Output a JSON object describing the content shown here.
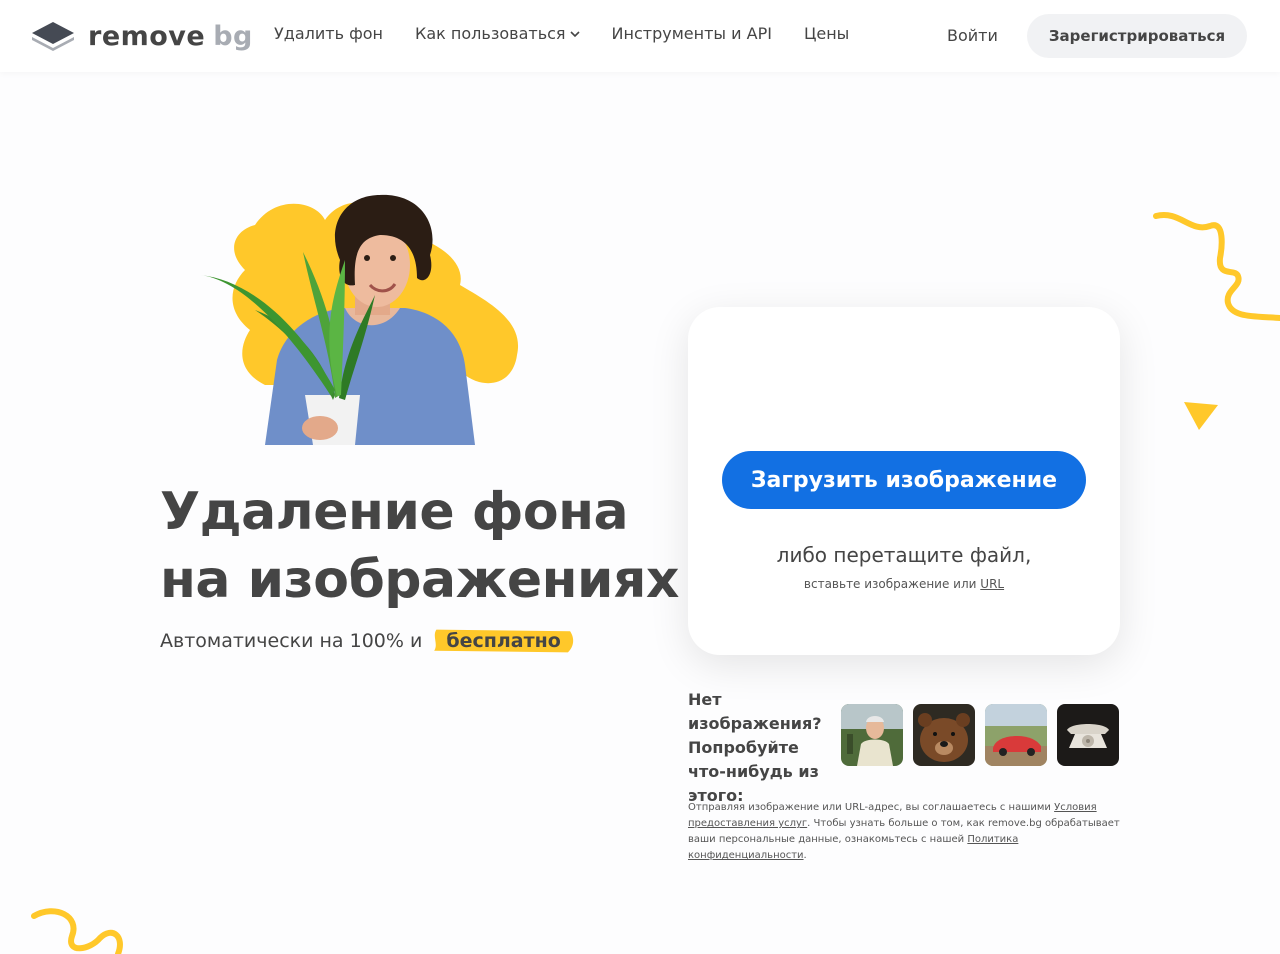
{
  "brand": {
    "name_part1": "remove",
    "name_part2": "bg",
    "accent": "#1270e3",
    "highlight": "#ffc82a"
  },
  "nav": {
    "items": [
      {
        "label": "Удалить фон"
      },
      {
        "label": "Как пользоваться"
      },
      {
        "label": "Инструменты и API"
      },
      {
        "label": "Цены"
      }
    ],
    "login_label": "Войти",
    "signup_label": "Зарегистрироваться"
  },
  "hero": {
    "headline_line1": "Удаление фона",
    "headline_line2": "на изображениях",
    "sub_prefix": "Автоматически на 100% и",
    "sub_highlight": "бесплатно"
  },
  "upload": {
    "button_label": "Загрузить изображение",
    "drop_text": "либо перетащите файл,",
    "paste_prefix": "вставьте изображение или",
    "paste_link": "URL"
  },
  "samples": {
    "label": "Нет изображения? Попробуйте что-нибудь из этого:",
    "thumbs": [
      "man-photo",
      "bear-photo",
      "car-photo",
      "telephone-photo"
    ]
  },
  "legal": {
    "text1": "Отправляя изображение или URL-адрес, вы соглашаетесь с нашими",
    "terms_link": "Условия предоставления услуг",
    "text2": ". Чтобы узнать больше о том, как remove.bg обрабатывает ваши персональные данные, ознакомьтесь с нашей",
    "privacy_link": "Политика конфиденциальности",
    "text3": "."
  }
}
